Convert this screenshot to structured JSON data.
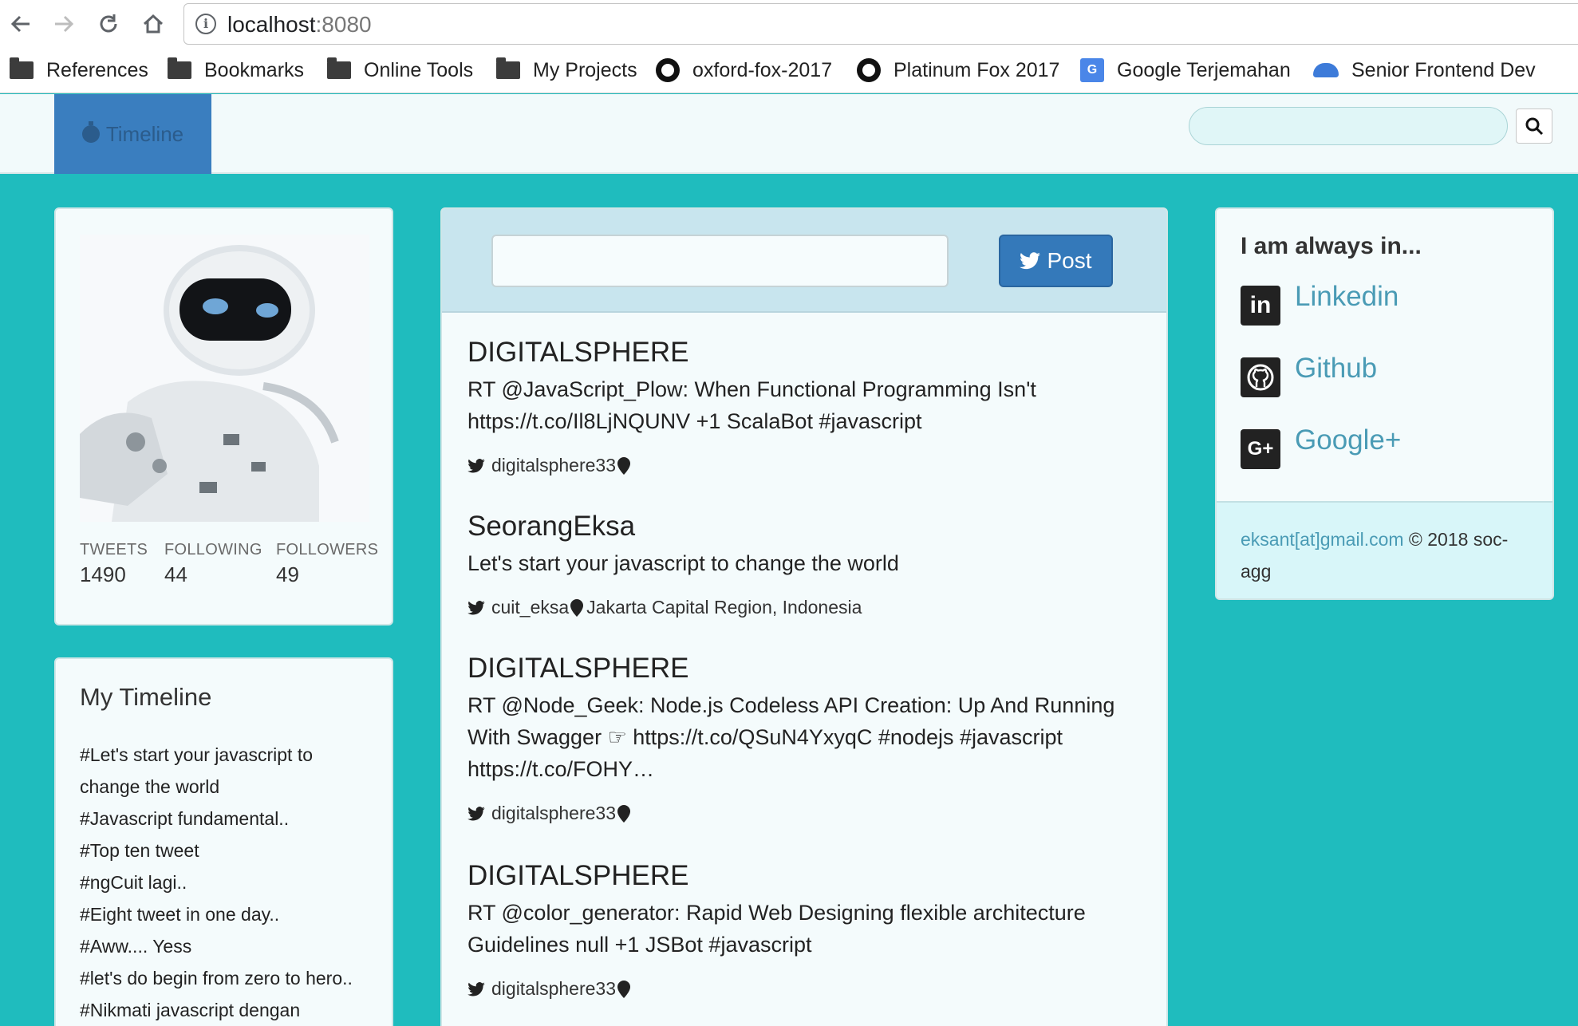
{
  "browser": {
    "url_host": "localhost",
    "url_port": ":8080",
    "bookmarks": [
      {
        "label": "References",
        "icon": "folder-icon"
      },
      {
        "label": "Bookmarks",
        "icon": "folder-icon"
      },
      {
        "label": "Online Tools",
        "icon": "folder-icon"
      },
      {
        "label": "My Projects",
        "icon": "folder-icon"
      },
      {
        "label": "oxford-fox-2017",
        "icon": "github-icon"
      },
      {
        "label": "Platinum Fox 2017",
        "icon": "github-icon"
      },
      {
        "label": "Google Terjemahan",
        "icon": "google-translate-icon"
      },
      {
        "label": "Senior Frontend Dev",
        "icon": "cloud-icon"
      }
    ]
  },
  "navbar": {
    "brand_label": "Timeline",
    "search_placeholder": ""
  },
  "profile": {
    "stats": [
      {
        "label": "TWEETS",
        "value": "1490"
      },
      {
        "label": "FOLLOWING",
        "value": "44"
      },
      {
        "label": "FOLLOWERS",
        "value": "49"
      }
    ]
  },
  "my_timeline": {
    "title": "My Timeline",
    "items": [
      "#Let's start your javascript to change the world",
      "#Javascript fundamental..",
      "#Top ten tweet",
      "#ngCuit lagi..",
      "#Eight tweet in one day..",
      "#Aww.... Yess",
      "#let's do begin from zero to hero..",
      "#Nikmati javascript dengan"
    ]
  },
  "compose": {
    "input_placeholder": "",
    "post_label": "Post"
  },
  "tweets": [
    {
      "author": "DIGITALSPHERE",
      "text": "RT @JavaScript_Plow: When Functional Programming Isn't https://t.co/Il8LjNQUNV +1 ScalaBot #javascript",
      "handle": "digitalsphere33",
      "location": ""
    },
    {
      "author": "SeorangEksa",
      "text": "Let's start your javascript to change the world",
      "handle": "cuit_eksa",
      "location": "Jakarta Capital Region, Indonesia"
    },
    {
      "author": "DIGITALSPHERE",
      "text": "RT @Node_Geek: Node.js Codeless API Creation: Up And Running With Swagger ☞ https://t.co/QSuN4YxyqC #nodejs #javascript https://t.co/FOHY…",
      "handle": "digitalsphere33",
      "location": ""
    },
    {
      "author": "DIGITALSPHERE",
      "text": "RT @color_generator: Rapid Web Designing flexible architecture Guidelines null +1 JSBot #javascript",
      "handle": "digitalsphere33",
      "location": ""
    }
  ],
  "links": {
    "title": "I am always in...",
    "items": [
      {
        "label": "Linkedin",
        "icon": "linkedin-icon",
        "glyph": "in"
      },
      {
        "label": "Github",
        "icon": "github-icon",
        "glyph": ""
      },
      {
        "label": "Google+",
        "icon": "google-plus-icon",
        "glyph": "G+"
      }
    ],
    "footer_email": "eksant[at]gmail.com",
    "footer_text": " © 2018 soc-agg"
  },
  "colors": {
    "page_background": "#1fbcbe",
    "brand_blue": "#3a7ebf",
    "link_color": "#4a9bb5"
  }
}
